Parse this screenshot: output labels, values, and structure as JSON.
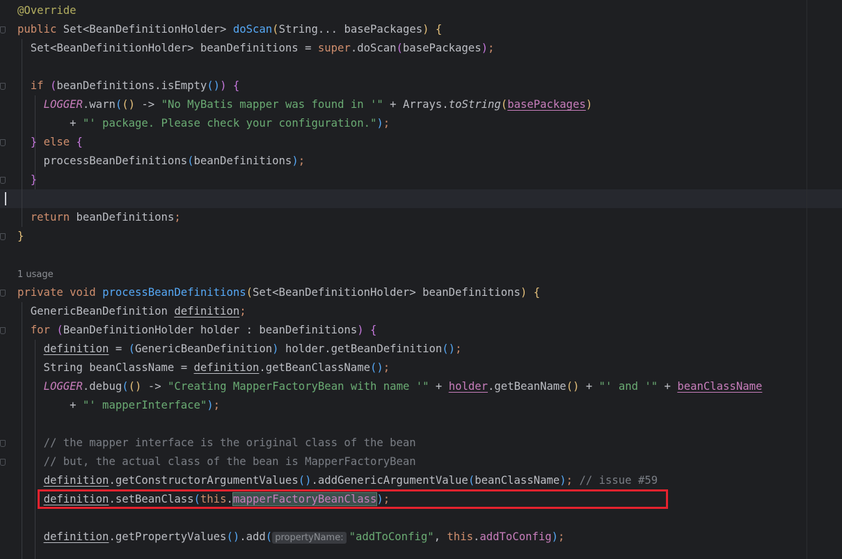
{
  "lines": [
    {
      "parts": [
        {
          "t": "@Override",
          "c": "ann"
        }
      ]
    },
    {
      "parts": [
        {
          "t": "public ",
          "c": "kw"
        },
        {
          "t": "Set<BeanDefinitionHolder> "
        },
        {
          "t": "doScan",
          "c": "fn"
        },
        {
          "t": "(",
          "c": "p1"
        },
        {
          "t": "String... basePackages"
        },
        {
          "t": ")",
          "c": "p1"
        },
        {
          "t": " "
        },
        {
          "t": "{",
          "c": "p1"
        }
      ]
    },
    {
      "parts": [
        {
          "t": "  Set<BeanDefinitionHolder> beanDefinitions = "
        },
        {
          "t": "super",
          "c": "kw"
        },
        {
          "t": ".doScan"
        },
        {
          "t": "(",
          "c": "p2"
        },
        {
          "t": "basePackages"
        },
        {
          "t": ")",
          "c": "p2"
        },
        {
          "t": ";",
          "c": "semi"
        }
      ]
    },
    {
      "parts": [
        {
          "t": ""
        }
      ]
    },
    {
      "parts": [
        {
          "t": "  "
        },
        {
          "t": "if",
          "c": "kw"
        },
        {
          "t": " "
        },
        {
          "t": "(",
          "c": "p2"
        },
        {
          "t": "beanDefinitions.isEmpty"
        },
        {
          "t": "()",
          "c": "p3"
        },
        {
          "t": ")",
          "c": "p2"
        },
        {
          "t": " "
        },
        {
          "t": "{",
          "c": "p2"
        }
      ]
    },
    {
      "parts": [
        {
          "t": "    "
        },
        {
          "t": "LOGGER",
          "c": "sfld"
        },
        {
          "t": ".warn"
        },
        {
          "t": "(",
          "c": "p3"
        },
        {
          "t": "()",
          "c": "p1"
        },
        {
          "t": " -> "
        },
        {
          "t": "\"No MyBatis mapper was found in '\"",
          "c": "str"
        },
        {
          "t": " + Arrays."
        },
        {
          "t": "toString",
          "c": "it"
        },
        {
          "t": "(",
          "c": "p1"
        },
        {
          "t": "basePackages",
          "c": "fld ul"
        },
        {
          "t": ")",
          "c": "p1"
        }
      ]
    },
    {
      "parts": [
        {
          "t": "        + "
        },
        {
          "t": "\"' package. Please check your configuration.\"",
          "c": "str"
        },
        {
          "t": ")",
          "c": "p3"
        },
        {
          "t": ";",
          "c": "semi"
        }
      ]
    },
    {
      "parts": [
        {
          "t": "  "
        },
        {
          "t": "}",
          "c": "p2"
        },
        {
          "t": " "
        },
        {
          "t": "else",
          "c": "kw"
        },
        {
          "t": " "
        },
        {
          "t": "{",
          "c": "p2"
        }
      ]
    },
    {
      "parts": [
        {
          "t": "    processBeanDefinitions"
        },
        {
          "t": "(",
          "c": "p3"
        },
        {
          "t": "beanDefinitions"
        },
        {
          "t": ")",
          "c": "p3"
        },
        {
          "t": ";",
          "c": "semi"
        }
      ]
    },
    {
      "parts": [
        {
          "t": "  "
        },
        {
          "t": "}",
          "c": "p2"
        }
      ]
    },
    {
      "parts": [
        {
          "t": ""
        }
      ]
    },
    {
      "parts": [
        {
          "t": "  "
        },
        {
          "t": "return",
          "c": "kw"
        },
        {
          "t": " beanDefinitions"
        },
        {
          "t": ";",
          "c": "semi"
        }
      ]
    },
    {
      "parts": [
        {
          "t": "}",
          "c": "p1"
        }
      ]
    },
    {
      "parts": [
        {
          "t": ""
        }
      ]
    },
    {
      "usage": "1 usage"
    },
    {
      "parts": [
        {
          "t": "private ",
          "c": "kw"
        },
        {
          "t": "void ",
          "c": "kw"
        },
        {
          "t": "processBeanDefinitions",
          "c": "fn"
        },
        {
          "t": "(",
          "c": "p1"
        },
        {
          "t": "Set<BeanDefinitionHolder> beanDefinitions"
        },
        {
          "t": ")",
          "c": "p1"
        },
        {
          "t": " "
        },
        {
          "t": "{",
          "c": "p1"
        }
      ]
    },
    {
      "parts": [
        {
          "t": "  GenericBeanDefinition "
        },
        {
          "t": "definition",
          "c": "ul"
        },
        {
          "t": ";",
          "c": "semi"
        }
      ]
    },
    {
      "parts": [
        {
          "t": "  "
        },
        {
          "t": "for",
          "c": "kw"
        },
        {
          "t": " "
        },
        {
          "t": "(",
          "c": "p2"
        },
        {
          "t": "BeanDefinitionHolder holder : beanDefinitions"
        },
        {
          "t": ")",
          "c": "p2"
        },
        {
          "t": " "
        },
        {
          "t": "{",
          "c": "p2"
        }
      ]
    },
    {
      "parts": [
        {
          "t": "    "
        },
        {
          "t": "definition",
          "c": "ul"
        },
        {
          "t": " = "
        },
        {
          "t": "(",
          "c": "p3"
        },
        {
          "t": "GenericBeanDefinition"
        },
        {
          "t": ")",
          "c": "p3"
        },
        {
          "t": " holder.getBeanDefinition"
        },
        {
          "t": "()",
          "c": "p3"
        },
        {
          "t": ";",
          "c": "semi"
        }
      ]
    },
    {
      "parts": [
        {
          "t": "    String beanClassName = "
        },
        {
          "t": "definition",
          "c": "ul"
        },
        {
          "t": ".getBeanClassName"
        },
        {
          "t": "()",
          "c": "p3"
        },
        {
          "t": ";",
          "c": "semi"
        }
      ]
    },
    {
      "parts": [
        {
          "t": "    "
        },
        {
          "t": "LOGGER",
          "c": "sfld"
        },
        {
          "t": ".debug"
        },
        {
          "t": "(",
          "c": "p3"
        },
        {
          "t": "()",
          "c": "p1"
        },
        {
          "t": " -> "
        },
        {
          "t": "\"Creating MapperFactoryBean with name '\"",
          "c": "str"
        },
        {
          "t": " + "
        },
        {
          "t": "holder",
          "c": "fld ul"
        },
        {
          "t": ".getBeanName"
        },
        {
          "t": "()",
          "c": "p1"
        },
        {
          "t": " + "
        },
        {
          "t": "\"' and '\"",
          "c": "str"
        },
        {
          "t": " + "
        },
        {
          "t": "beanClassName",
          "c": "fld ul"
        }
      ]
    },
    {
      "parts": [
        {
          "t": "        + "
        },
        {
          "t": "\"' mapperInterface\"",
          "c": "str"
        },
        {
          "t": ")",
          "c": "p3"
        },
        {
          "t": ";",
          "c": "semi"
        }
      ]
    },
    {
      "parts": [
        {
          "t": ""
        }
      ]
    },
    {
      "parts": [
        {
          "t": "    "
        },
        {
          "t": "// the mapper interface is the original class of the bean",
          "c": "cmt"
        }
      ]
    },
    {
      "parts": [
        {
          "t": "    "
        },
        {
          "t": "// but, the actual class of the bean is MapperFactoryBean",
          "c": "cmt"
        }
      ]
    },
    {
      "parts": [
        {
          "t": "    "
        },
        {
          "t": "definition",
          "c": "ul"
        },
        {
          "t": ".getConstructorArgumentValues"
        },
        {
          "t": "()",
          "c": "p3"
        },
        {
          "t": ".addGenericArgumentValue"
        },
        {
          "t": "(",
          "c": "p3"
        },
        {
          "t": "beanClassName"
        },
        {
          "t": ")",
          "c": "p3"
        },
        {
          "t": ";",
          "c": "semi"
        },
        {
          "t": " // issue #59",
          "c": "cmt"
        }
      ]
    },
    {
      "parts": [
        {
          "t": "    "
        },
        {
          "t": "definition",
          "c": "ul"
        },
        {
          "t": ".setBeanClass"
        },
        {
          "t": "(",
          "c": "p3"
        },
        {
          "t": "this",
          "c": "kw"
        },
        {
          "t": "."
        },
        {
          "t": "mapperFactoryBeanClass",
          "c": "fld sel"
        },
        {
          "t": ")",
          "c": "p3"
        },
        {
          "t": ";",
          "c": "semi"
        }
      ]
    },
    {
      "parts": [
        {
          "t": ""
        }
      ]
    },
    {
      "parts": [
        {
          "t": "    "
        },
        {
          "t": "definition",
          "c": "ul"
        },
        {
          "t": ".getPropertyValues"
        },
        {
          "t": "()",
          "c": "p3"
        },
        {
          "t": ".add"
        },
        {
          "t": "(",
          "c": "p3"
        },
        {
          "hint": "propertyName:"
        },
        {
          "t": "\"addToConfig\"",
          "c": "str"
        },
        {
          "t": ", "
        },
        {
          "t": "this",
          "c": "kw"
        },
        {
          "t": "."
        },
        {
          "t": "addToConfig",
          "c": "fld"
        },
        {
          "t": ")",
          "c": "p3"
        },
        {
          "t": ";",
          "c": "semi"
        }
      ]
    }
  ]
}
